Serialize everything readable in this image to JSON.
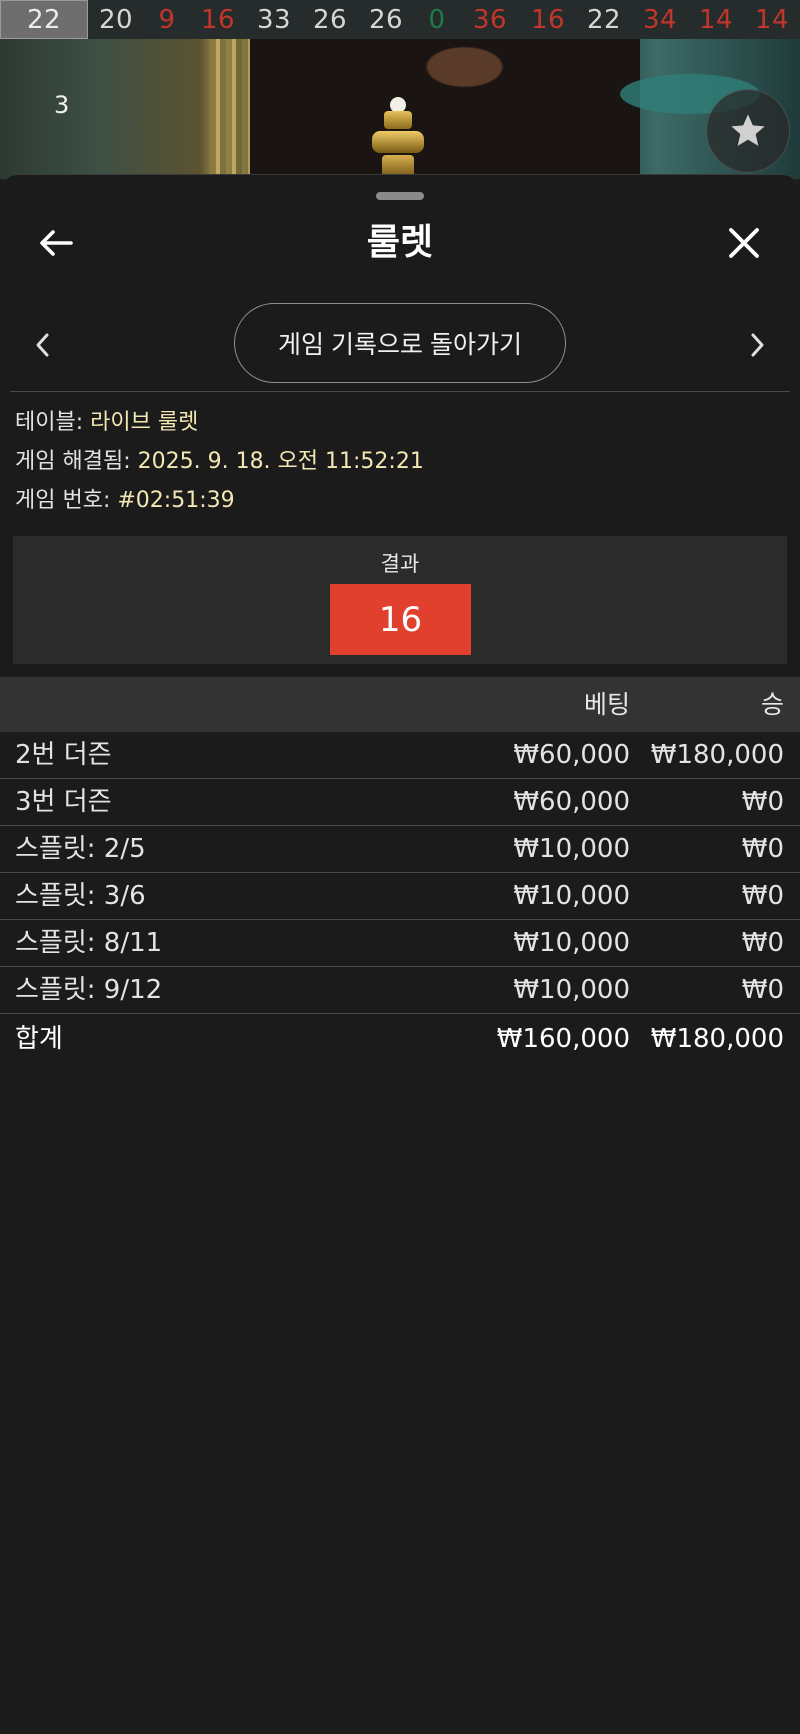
{
  "results_strip": [
    {
      "value": "22",
      "color": "black",
      "latest": true
    },
    {
      "value": "20",
      "color": "black"
    },
    {
      "value": "9",
      "color": "red"
    },
    {
      "value": "16",
      "color": "red"
    },
    {
      "value": "33",
      "color": "black"
    },
    {
      "value": "26",
      "color": "black"
    },
    {
      "value": "26",
      "color": "black"
    },
    {
      "value": "0",
      "color": "green"
    },
    {
      "value": "36",
      "color": "red"
    },
    {
      "value": "16",
      "color": "red"
    },
    {
      "value": "22",
      "color": "black"
    },
    {
      "value": "34",
      "color": "red"
    },
    {
      "value": "14",
      "color": "red"
    },
    {
      "value": "14",
      "color": "red"
    }
  ],
  "video": {
    "side_label": "3",
    "favorite_icon": "star-icon"
  },
  "header": {
    "title": "룰렛",
    "back_icon": "arrow-left-icon",
    "close_icon": "close-icon"
  },
  "nav": {
    "back_to_history_label": "게임 기록으로 돌아가기",
    "prev_icon": "chevron-left-icon",
    "next_icon": "chevron-right-icon"
  },
  "info": {
    "table_label": "테이블:",
    "table_value": "라이브 룰렛",
    "resolved_label": "게임 해결됨:",
    "resolved_value": "2025. 9. 18. 오전 11:52:21",
    "game_no_label": "게임 번호:",
    "game_no_value": "#02:51:39"
  },
  "result": {
    "title": "결과",
    "number": "16",
    "color": "#e2402f"
  },
  "table": {
    "head_bet": "베팅",
    "head_win": "승",
    "rows": [
      {
        "name": "2번 더즌",
        "bet": "₩60,000",
        "win": "₩180,000"
      },
      {
        "name": "3번 더즌",
        "bet": "₩60,000",
        "win": "₩0"
      },
      {
        "name": "스플릿: 2/5",
        "bet": "₩10,000",
        "win": "₩0"
      },
      {
        "name": "스플릿: 3/6",
        "bet": "₩10,000",
        "win": "₩0"
      },
      {
        "name": "스플릿: 8/11",
        "bet": "₩10,000",
        "win": "₩0"
      },
      {
        "name": "스플릿: 9/12",
        "bet": "₩10,000",
        "win": "₩0"
      }
    ],
    "total": {
      "name": "합계",
      "bet": "₩160,000",
      "win": "₩180,000"
    }
  },
  "colors": {
    "red_number": "#c2352b",
    "green_number": "#1f7a4a",
    "info_value": "#f3e7b3",
    "sheet_bg": "#1b1b1b"
  }
}
